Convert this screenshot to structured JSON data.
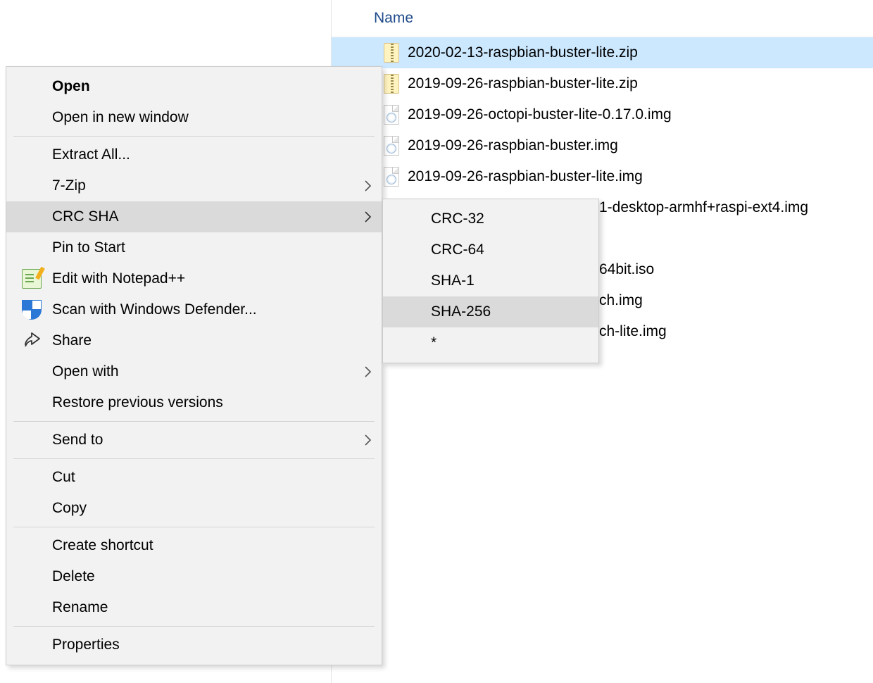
{
  "filelist": {
    "header": "Name",
    "items": [
      {
        "name": "2020-02-13-raspbian-buster-lite.zip",
        "type": "zip",
        "selected": true
      },
      {
        "name": "2019-09-26-raspbian-buster-lite.zip",
        "type": "zip",
        "selected": false
      },
      {
        "name": "2019-09-26-octopi-buster-lite-0.17.0.img",
        "type": "img",
        "selected": false
      },
      {
        "name": "2019-09-26-raspbian-buster.img",
        "type": "img",
        "selected": false
      },
      {
        "name": "2019-09-26-raspbian-buster-lite.img",
        "type": "img",
        "selected": false
      },
      {
        "name": "1-desktop-armhf+raspi-ext4.img",
        "type": "img",
        "selected": false
      },
      {
        "name": "",
        "type": "img",
        "selected": false
      },
      {
        "name": "64bit.iso",
        "type": "img",
        "selected": false
      },
      {
        "name": "ch.img",
        "type": "img",
        "selected": false
      },
      {
        "name": "ch-lite.img",
        "type": "img",
        "selected": false
      }
    ]
  },
  "filelist_visible_label_partial_5": "1-desktop-armhf+raspi-ext4.img",
  "context_menu": {
    "open": "Open",
    "open_new_window": "Open in new window",
    "extract_all": "Extract All...",
    "seven_zip": "7-Zip",
    "crc_sha": "CRC SHA",
    "pin_to_start": "Pin to Start",
    "edit_notepadpp": "Edit with Notepad++",
    "scan_defender": "Scan with Windows Defender...",
    "share": "Share",
    "open_with": "Open with",
    "restore_prev": "Restore previous versions",
    "send_to": "Send to",
    "cut": "Cut",
    "copy": "Copy",
    "create_shortcut": "Create shortcut",
    "delete": "Delete",
    "rename": "Rename",
    "properties": "Properties"
  },
  "submenu": {
    "crc32": "CRC-32",
    "crc64": "CRC-64",
    "sha1": "SHA-1",
    "sha256": "SHA-256",
    "star": "*"
  },
  "right_side_partials": {
    "row5_suffix": "1-desktop-armhf+raspi-ext4.img",
    "row7_suffix": "64bit.iso",
    "row8_suffix": "ch.img",
    "row9_suffix": "ch-lite.img"
  }
}
